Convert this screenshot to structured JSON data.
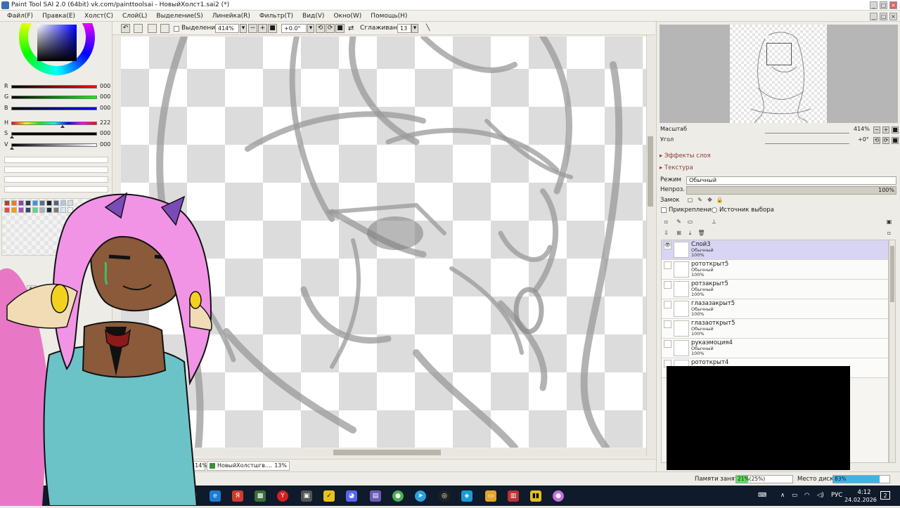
{
  "window": {
    "title": "Paint Tool SAI 2.0 (64bit) vk.com/painttoolsai - НовыйХолст1.sai2 (*)"
  },
  "menu": [
    "Файл(F)",
    "Правка(E)",
    "Холст(C)",
    "Слой(L)",
    "Выделение(S)",
    "Линейка(R)",
    "Фильтр(T)",
    "Вид(V)",
    "Окно(W)",
    "Помощь(H)"
  ],
  "color_panel": {
    "sliders": [
      {
        "label": "R",
        "value": "000"
      },
      {
        "label": "G",
        "value": "000"
      },
      {
        "label": "B",
        "value": "000"
      },
      {
        "label": "H",
        "value": "222"
      },
      {
        "label": "S",
        "value": "000"
      },
      {
        "label": "V",
        "value": "000"
      }
    ],
    "swatches": [
      "#c0392b",
      "#e67e22",
      "#8e44ad",
      "#2c3e50",
      "#3498db",
      "#5d6d7e",
      "#1b2631",
      "#566573",
      "#a9cce3",
      "#d5dbdb",
      "#e74c3c",
      "#f39c12",
      "#9b59b6",
      "#34495e",
      "#58d68d",
      "#abb2b9",
      "#212f3d",
      "#7b7d7d",
      "#d6eaf8",
      "#f2f3f4"
    ]
  },
  "canvas_toolbar": {
    "selection_label": "Выделение",
    "zoom": "414%",
    "rotation": "+0.0°",
    "smoothing_label": "Сглаживание",
    "smoothing_value": "13"
  },
  "doc_tabs": [
    {
      "label": "414%"
    },
    {
      "label": "НовыйХолстшгв....",
      "zoom": "13%"
    }
  ],
  "navigator": {
    "scale_label": "Масштаб",
    "scale_value": "414%",
    "angle_label": "Угол",
    "angle_value": "+0°"
  },
  "layer_props": {
    "effects": "Эффекты слоя",
    "texture": "Текстура",
    "mode_label": "Режим",
    "mode_value": "Обычный",
    "opacity_label": "Непроз.",
    "opacity_value": "100%",
    "lock_label": "Замок",
    "clip_label": "Прикрепление",
    "source_label": "Источник выбора"
  },
  "layers": [
    {
      "name": "Слой3",
      "mode": "Обычный",
      "opacity": "100%",
      "selected": true
    },
    {
      "name": "рототкрыт5",
      "mode": "Обычный",
      "opacity": "100%"
    },
    {
      "name": "ротзакрыт5",
      "mode": "Обычный",
      "opacity": "100%"
    },
    {
      "name": "глазазакрыт5",
      "mode": "Обычный",
      "opacity": "100%"
    },
    {
      "name": "глазаоткрыт5",
      "mode": "Обычный",
      "opacity": "100%"
    },
    {
      "name": "рукаэмоция4",
      "mode": "Обычный",
      "opacity": "100%"
    },
    {
      "name": "рототкрыт4",
      "mode": "",
      "opacity": ""
    }
  ],
  "status": {
    "memory_label": "Памяти занято",
    "memory_value": "21%(25%)",
    "memory_fraction": 0.21,
    "disk_label": "Место диска",
    "disk_value": "83%",
    "disk_fraction": 0.83
  },
  "taskbar": {
    "language": "РУС",
    "time": "4:12",
    "date": "24.02.2026",
    "notifications": "2"
  },
  "colors": {
    "selected_layer": "#d7d5f3",
    "memory_fill": "#5fdc5f",
    "disk_fill": "#38b6e8",
    "taskbar": "#0f1a2a"
  }
}
